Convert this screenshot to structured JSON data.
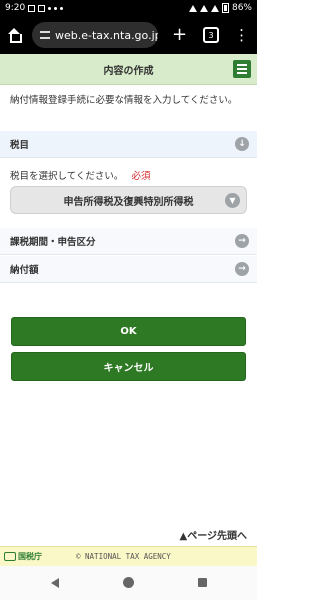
{
  "status": {
    "time": "9:20",
    "battery": "86%"
  },
  "browser": {
    "url": "web.e-tax.nta.go.jp",
    "tab_count": "3"
  },
  "header": {
    "title": "内容の作成"
  },
  "intro": "納付情報登録手続に必要な情報を入力してください。",
  "sections": {
    "tax_item": {
      "label": "税目"
    },
    "select_prompt": "税目を選択してください。",
    "required": "必須",
    "selected_tax": "申告所得税及復興特別所得税",
    "period": {
      "label": "課税期間・申告区分"
    },
    "amount": {
      "label": "納付額"
    }
  },
  "buttons": {
    "ok": "OK",
    "cancel": "キャンセル"
  },
  "page_top": "▲ページ先頭へ",
  "footer": {
    "logo": "国税庁",
    "copyright": "© NATIONAL TAX AGENCY"
  },
  "colors": {
    "primary_green": "#2e7a24",
    "header_bg": "#d8eccb",
    "required_red": "#d32f2f"
  }
}
